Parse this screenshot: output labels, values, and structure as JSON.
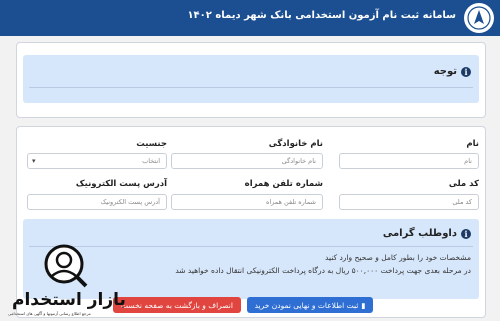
{
  "header": {
    "title": "سامانه ثبت نام آزمون استخدامی بانک شهر دیماه ۱۴۰۲",
    "accent": "#1b4f91"
  },
  "notice": {
    "title": "توجه"
  },
  "form": {
    "name": {
      "label": "نام",
      "placeholder": "نام"
    },
    "family": {
      "label": "نام خانوادگی",
      "placeholder": "نام خانوادگی"
    },
    "gender": {
      "label": "جنسیت",
      "selected": "انتخاب"
    },
    "national_code": {
      "label": "کد ملی",
      "placeholder": "کد ملی"
    },
    "mobile": {
      "label": "شماره تلفن همراه",
      "placeholder": "شماره تلفن همراه"
    },
    "email": {
      "label": "آدرس پست الکترونیک",
      "placeholder": "آدرس پست الکترونیک"
    }
  },
  "candidate": {
    "title": "داوطلب گرامی",
    "line1": "مشخصات خود را بطور کامل و صحیح وارد کنید",
    "line2": "در مرحله بعدی جهت پرداخت ۵۰۰,۰۰۰ ریال به درگاه پرداخت الکترونیکی انتقال داده خواهید شد"
  },
  "buttons": {
    "submit": "ثبت اطلاعات و نهایی نمودن خرید",
    "cancel": "انصراف و بازگشت به صفحه نخست"
  },
  "watermark": {
    "title": "بازار استخدام",
    "subtitle": "مرجع اطلاع رسانی آزمونها و آگهی های استخدامی"
  },
  "colors": {
    "submit": "#2f6fd3",
    "cancel": "#e0453f",
    "info_box": "#d6e7fb"
  }
}
